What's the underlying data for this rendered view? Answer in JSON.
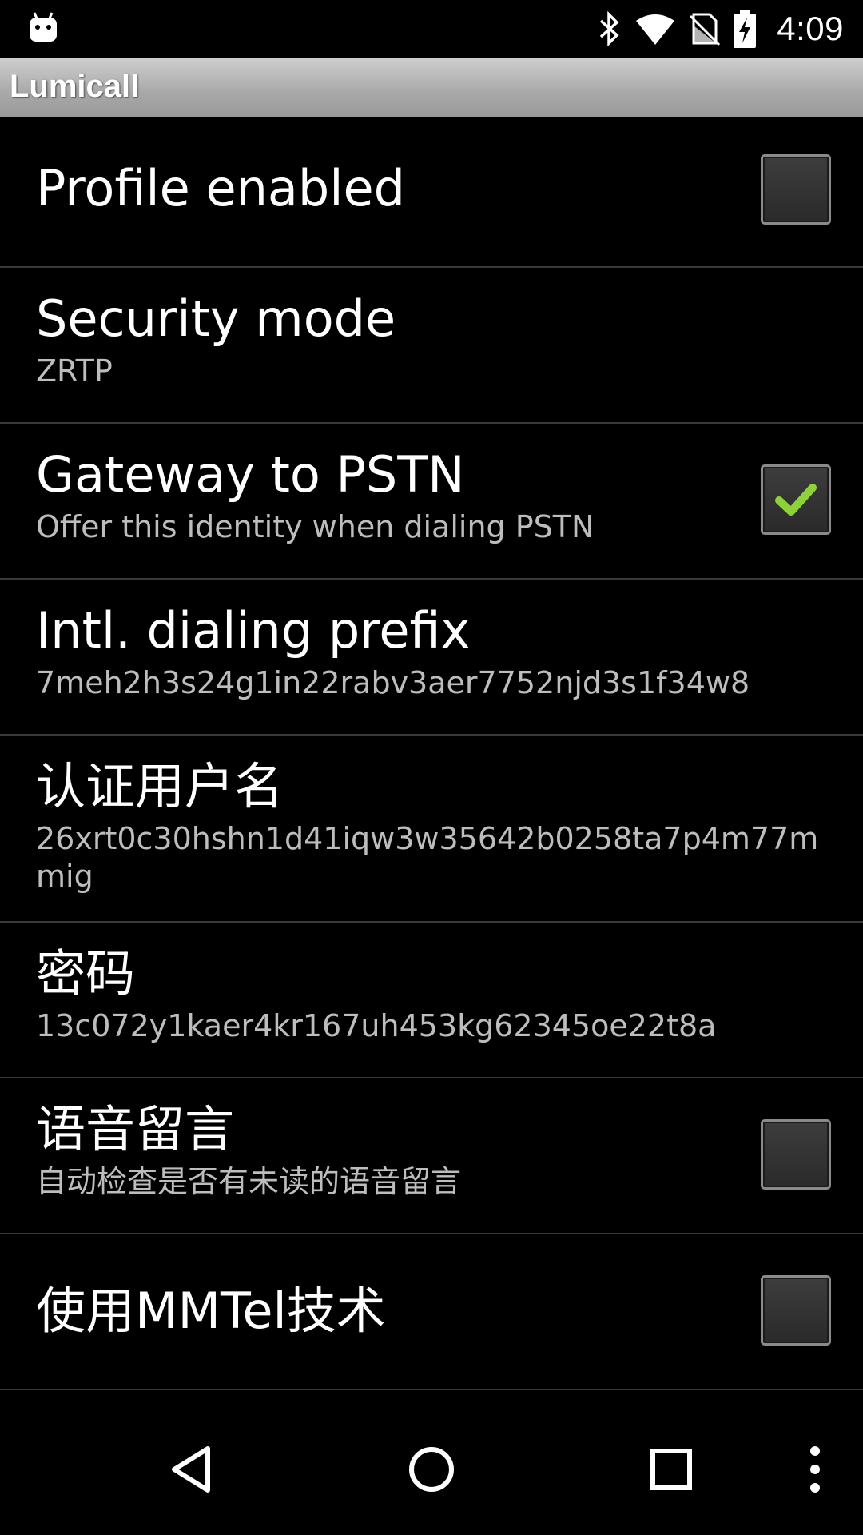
{
  "status_bar": {
    "time": "4:09",
    "icons": [
      "android-notification-icon",
      "bluetooth-icon",
      "wifi-icon",
      "no-sim-icon",
      "battery-charging-icon"
    ]
  },
  "app_bar": {
    "title": "Lumicall"
  },
  "preferences": {
    "profile_enabled": {
      "title": "Profile enabled",
      "checked": false
    },
    "security_mode": {
      "title": "Security mode",
      "summary": "ZRTP"
    },
    "gateway": {
      "title": "Gateway to PSTN",
      "summary": "Offer this identity when dialing PSTN",
      "checked": true
    },
    "intl_prefix": {
      "title": "Intl. dialing prefix",
      "summary": "7meh2h3s24g1in22rabv3aer7752njd3s1f34w8"
    },
    "auth_username": {
      "title": "认证用户名",
      "summary": "26xrt0c30hshn1d41iqw3w35642b0258ta7p4m77mmig"
    },
    "password": {
      "title": "密码",
      "summary": "13c072y1kaer4kr167uh453kg62345oe22t8a"
    },
    "voicemail": {
      "title": "语音留言",
      "summary": "自动检查是否有未读的语音留言",
      "checked": false
    },
    "mmtel": {
      "title": "使用MMTel技术",
      "checked": false
    }
  },
  "colors": {
    "check_mark": "#8fd13a",
    "summary_text": "#bdbdbd",
    "divider": "#3a3a3a"
  },
  "nav_bar": {
    "buttons": [
      "back-icon",
      "home-icon",
      "recents-icon",
      "overflow-menu-icon"
    ]
  }
}
